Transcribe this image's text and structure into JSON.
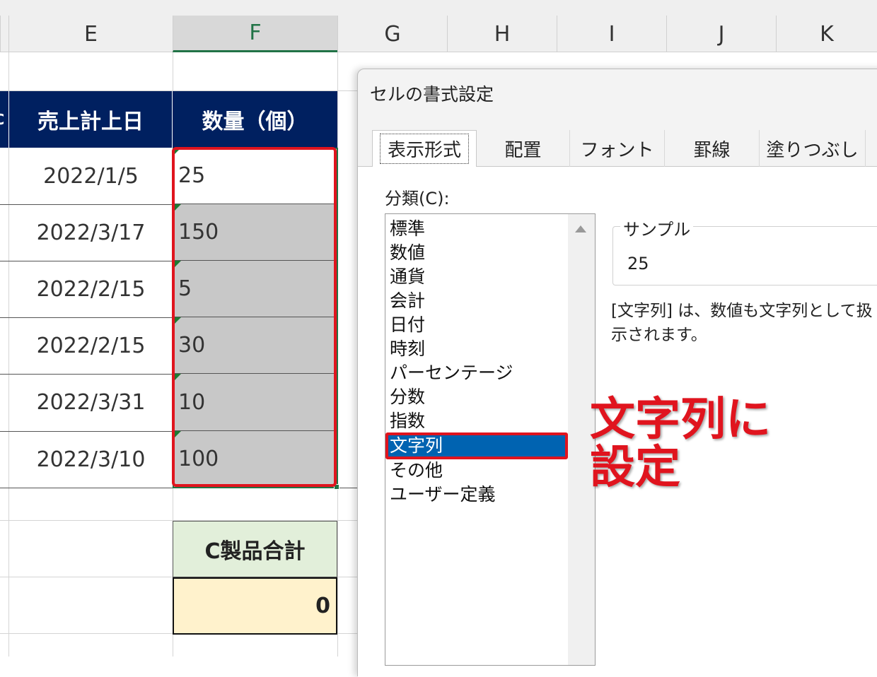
{
  "columns": [
    "E",
    "F",
    "G",
    "H",
    "I",
    "J",
    "K"
  ],
  "table": {
    "header_cut_char": "C",
    "headers": [
      "売上計上日",
      "数量（個）"
    ],
    "rows": [
      {
        "date": "2022/1/5",
        "qty": "25"
      },
      {
        "date": "2022/3/17",
        "qty": "150"
      },
      {
        "date": "2022/2/15",
        "qty": "5"
      },
      {
        "date": "2022/2/15",
        "qty": "30"
      },
      {
        "date": "2022/3/31",
        "qty": "10"
      },
      {
        "date": "2022/3/10",
        "qty": "100"
      }
    ]
  },
  "summary": {
    "label": "C製品合計",
    "value": "0"
  },
  "dialog": {
    "title": "セルの書式設定",
    "tabs": [
      "表示形式",
      "配置",
      "フォント",
      "罫線",
      "塗りつぶし"
    ],
    "active_tab": "表示形式",
    "category_label": "分類(C):",
    "categories": [
      "標準",
      "数値",
      "通貨",
      "会計",
      "日付",
      "時刻",
      "パーセンテージ",
      "分数",
      "指数",
      "文字列",
      "その他",
      "ユーザー定義"
    ],
    "selected_category": "文字列",
    "sample_label": "サンプル",
    "sample_value": "25",
    "description_line1": "[文字列] は、数値も文字列として扱",
    "description_line2": "示されます。"
  },
  "annotation": {
    "line1": "文字列に",
    "line2": "設定",
    "color": "#e0141e"
  },
  "colors": {
    "header_bg": "#002060",
    "highlight": "#e0141e",
    "selection_blue": "#0063b1",
    "excel_green": "#217346"
  }
}
